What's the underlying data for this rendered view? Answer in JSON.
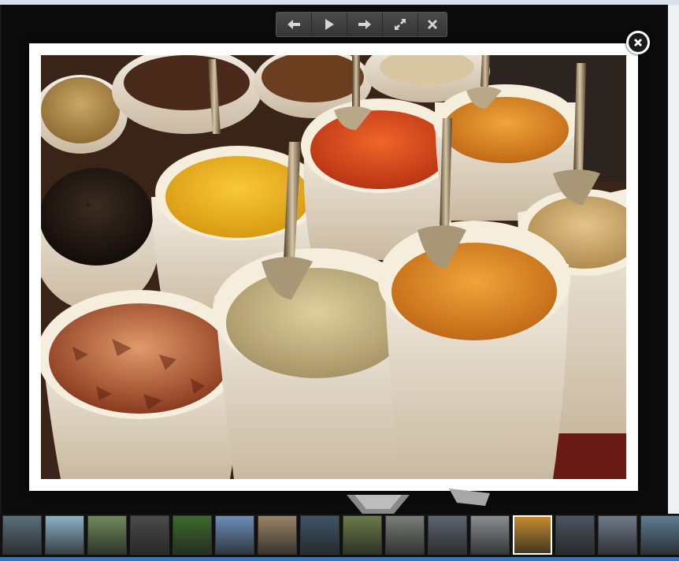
{
  "toolbar": {
    "buttons": [
      {
        "name": "previous-button",
        "icon": "arrow-left-icon"
      },
      {
        "name": "play-button",
        "icon": "play-icon"
      },
      {
        "name": "next-button",
        "icon": "arrow-right-icon"
      },
      {
        "name": "fullscreen-button",
        "icon": "expand-icon"
      },
      {
        "name": "close-toolbar-button",
        "icon": "close-icon"
      }
    ]
  },
  "viewer": {
    "image_subject": "spice sacks",
    "close_icon": "close-circle-icon"
  },
  "thumbnails": {
    "count": 16,
    "active_index": 12,
    "colors": [
      "#5b6f7a",
      "#8bb2c8",
      "#6f8a5a",
      "#4b4b4b",
      "#3d6b2c",
      "#6c8fb8",
      "#9a8468",
      "#3f5568",
      "#6c7a4a",
      "#7a7d7a",
      "#5e6570",
      "#8a8e90",
      "#c48b30",
      "#4b5460",
      "#6f7a8a",
      "#5e7c93"
    ]
  },
  "colors": {
    "background": "#0b0b0b",
    "frame": "#ffffff",
    "toolbar": "#3a3a3a",
    "accent_bar": "#2f76c5"
  }
}
